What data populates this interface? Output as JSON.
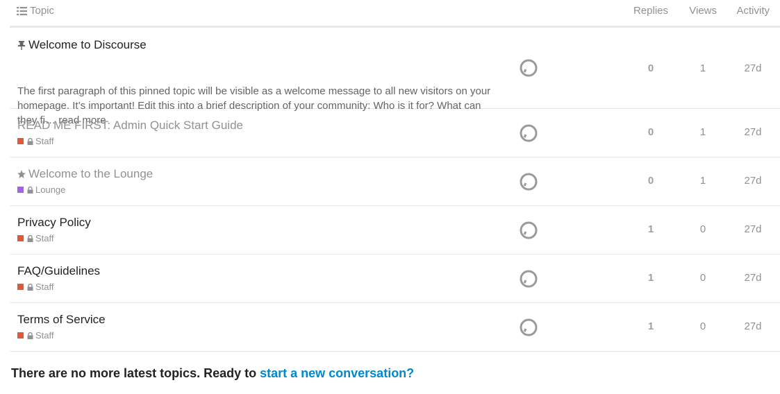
{
  "header": {
    "topic": "Topic",
    "replies": "Replies",
    "views": "Views",
    "activity": "Activity"
  },
  "topics": [
    {
      "title": "Welcome to Discourse",
      "excerpt": "The first paragraph of this pinned topic will be visible as a welcome message to all new visitors on your homepage. It’s important! Edit this into a brief description of your community: Who is it for? What can they fi…",
      "read_more": "read more",
      "replies": "0",
      "views": "1",
      "activity": "27d",
      "icon": "pin-icon"
    },
    {
      "title": "READ ME FIRST: Admin Quick Start Guide",
      "category": "Staff",
      "category_color": "#e45735",
      "replies": "0",
      "views": "1",
      "activity": "27d"
    },
    {
      "title": "Welcome to the Lounge",
      "category": "Lounge",
      "category_color": "#a461ef",
      "replies": "0",
      "views": "1",
      "activity": "27d",
      "icon": "star-icon"
    },
    {
      "title": "Privacy Policy",
      "category": "Staff",
      "category_color": "#e45735",
      "replies": "1",
      "views": "0",
      "activity": "27d"
    },
    {
      "title": "FAQ/Guidelines",
      "category": "Staff",
      "category_color": "#e45735",
      "replies": "1",
      "views": "0",
      "activity": "27d"
    },
    {
      "title": "Terms of Service",
      "category": "Staff",
      "category_color": "#e45735",
      "replies": "1",
      "views": "0",
      "activity": "27d"
    }
  ],
  "footer": {
    "text": "There are no more latest topics. Ready to ",
    "link": "start a new conversation?"
  },
  "colors": {
    "link": "#0088cc",
    "staff": "#e45735",
    "lounge": "#a461ef"
  }
}
